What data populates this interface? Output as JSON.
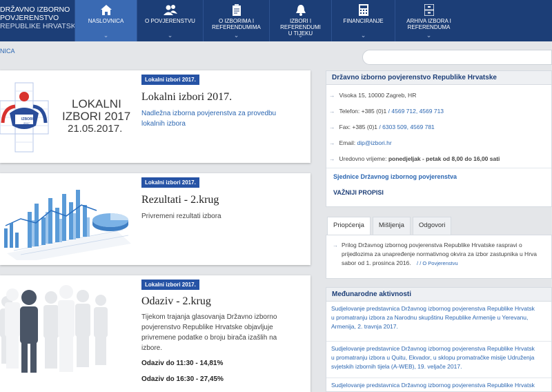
{
  "brand": {
    "line1": "DRŽAVNO IZBORNO",
    "line2": "POVJERENSTVO",
    "line3": "REPUBLIKE HRVATSKE"
  },
  "nav": [
    {
      "label1": "NASLOVNICA",
      "label2": "",
      "icon": "home-icon"
    },
    {
      "label1": "O POVJERENSTVU",
      "label2": "",
      "icon": "people-icon"
    },
    {
      "label1": "O IZBORIMA I",
      "label2": "REFERENDUMIMA",
      "icon": "clipboard-icon"
    },
    {
      "label1": "IZBORI I REFERENDUMI",
      "label2": "U TIJEKU",
      "icon": "bell-icon"
    },
    {
      "label1": "FINANCIRANJE",
      "label2": "",
      "icon": "calculator-icon"
    },
    {
      "label1": "ARHIVA IZBORA I",
      "label2": "REFERENDUMA",
      "icon": "archive-icon"
    }
  ],
  "breadcrumb": "NICA",
  "search": {
    "placeholder": ""
  },
  "cards": [
    {
      "tag": "Lokalni izbori 2017.",
      "title": "Lokalni izbori 2017.",
      "desc": "Nadležna izborna povjerenstva za provedbu lokalnih izbora",
      "image": {
        "line1": "LOKALNI",
        "line2": "IZBORI 2017",
        "line3": "21.05.2017.",
        "badge1": "IZBORI",
        "badge2": "2017"
      }
    },
    {
      "tag": "Lokalni izbori 2017.",
      "title": "Rezultati - 2.krug",
      "desc": "Privremeni rezultati izbora"
    },
    {
      "tag": "Lokalni izbori 2017.",
      "title": "Odaziv - 2.krug",
      "desc": "Tijekom trajanja glasovanja Državno izborno povjerenstvo Republike Hrvatske objavljuje privremene podatke o broju birača izašlih na izbore.",
      "stat1": "Odaziv do 11:30 - 14,81%",
      "stat2": "Odaziv do 16:30 - 27,45%"
    }
  ],
  "contact": {
    "title": "Državno izborno povjerenstvo Republike Hrvatske",
    "address": "Visoka 15, 10000 Zagreb, HR",
    "phone_label": "Telefon: +385 (0)1",
    "phone_sep": "/",
    "phone_value": "4569 712, 4569 713",
    "fax_label": "Fax: +385 (0)1",
    "fax_sep": "/",
    "fax_value": "6303 509, 4569 781",
    "email_label": "Email:",
    "email_value": "dip@izbori.hr",
    "hours_label": "Uredovno vrijeme:",
    "hours_value": "ponedjeljak - petak od 8,00 do 16,00 sati",
    "link1": "Sjednice Državnog izbornog povjerenstva",
    "link2": "VAŽNIJI PROPISI"
  },
  "tabs": [
    "Priopćenja",
    "Mišljenja",
    "Odgovori"
  ],
  "news": {
    "line1": "Prilog Državnog izbornog povjerenstva Republike Hrvatske raspravi o",
    "line2": "prijedlozima za unapređenje normativnog okvira za izbor zastupnika u Hrva",
    "line3": "sabor od 1. prosinca 2016.",
    "meta": "/ / O Povjerenstvu"
  },
  "intl": {
    "title": "Međunarodne aktivnosti",
    "items": [
      [
        "Sudjelovanje predstavnica Državnog izbornog povjerenstva Republike Hrvatsk",
        "u promatranju izbora za Narodnu skupštinu Republike Armenije u Yerevanu,",
        "Armenija, 2. travnja 2017."
      ],
      [
        "Sudjelovanje predstavnice Državnog izbornog povjerenstva Republike Hrvatsk",
        "u promatranju izbora u Quitu, Ekvador, u sklopu promatračke misije Udruženja",
        "svjetskih izbornih tijela (A-WEB), 19. veljače 2017."
      ],
      [
        "Sudjelovanje predstavnica Državnog izbornog povjerenstva Republike Hrvatsk",
        "",
        ""
      ]
    ]
  },
  "colors": {
    "nav_bg": "#1c3e77",
    "nav_active": "#3a6ab3",
    "tag_bg": "#2653a5",
    "link": "#2b66b1"
  }
}
